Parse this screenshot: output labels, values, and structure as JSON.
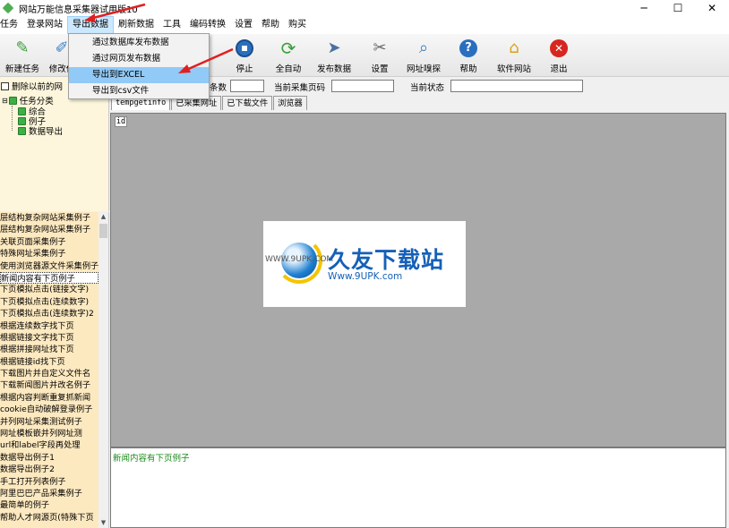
{
  "window": {
    "title": "网站万能信息采集器试用版10",
    "minimize": "─",
    "maximize": "☐",
    "close": "✕"
  },
  "menu": [
    "任务",
    "登录网站",
    "导出数据",
    "刷新数据",
    "工具",
    "编码转换",
    "设置",
    "帮助",
    "购买"
  ],
  "toolbar": [
    {
      "label": "新建任务",
      "icon": "new-task-icon"
    },
    {
      "label": "修改任",
      "icon": "edit-task-icon"
    },
    {
      "label": "停止",
      "icon": "stop-icon"
    },
    {
      "label": "全自动",
      "icon": "auto-icon"
    },
    {
      "label": "发布数据",
      "icon": "publish-icon"
    },
    {
      "label": "设置",
      "icon": "tools-icon"
    },
    {
      "label": "网址嗅探",
      "icon": "sniff-icon"
    },
    {
      "label": "帮助",
      "icon": "help-icon"
    },
    {
      "label": "软件网站",
      "icon": "home-icon"
    },
    {
      "label": "退出",
      "icon": "exit-icon"
    }
  ],
  "dropdown": [
    "通过数据库发布数据",
    "通过网页发布数据",
    "导出到EXCEL",
    "导出到csv文件"
  ],
  "left_panel": {
    "checkbox_label": "删除以前的网",
    "tree_root": "任务分类",
    "tree_children": [
      "综合",
      "例子",
      "数据导出"
    ]
  },
  "status": {
    "count_label": "条数",
    "page_label": "当前采集页码",
    "state_label": "当前状态",
    "count_value": "",
    "page_value": "",
    "state_value": ""
  },
  "tabs": [
    "tempgetinfo",
    "已采集网址",
    "已下载文件",
    "浏览器"
  ],
  "grid": {
    "column": "id"
  },
  "log": {
    "text": "新闻内容有下页例子"
  },
  "task_list": [
    "层结构复杂网站采集例子",
    "层结构复杂网站采集例子",
    "关联页面采集例子",
    "特殊网址采集例子",
    "使用浏览器源文件采集例子",
    "新闻内容有下页例子",
    "下页模拟点击(链接文字)",
    "下页模拟点击(连续数字)",
    "下页模拟点击(连续数字)2",
    "根据连续数字找下页",
    "根据链接文字找下页",
    "根据拼接网址找下页",
    "根据链接id找下页",
    "下载图片并自定义文件名",
    "下载新闻图片并改名例子",
    "根据内容判断重复抓新闻",
    "cookie自动破解登录例子",
    "并列网址采集测试例子",
    "网址模板嵌并列网址测",
    "url和label字段再处理",
    "数据导出例子1",
    "数据导出例子2",
    "手工打开列表例子",
    "阿里巴巴产品采集例子",
    "最简单的例子",
    "帮助人才网源页(特殊下页"
  ],
  "watermark": {
    "title": "久友下载站",
    "url": "Www.9UPK.com",
    "small": "WWW.9UPK.COM"
  }
}
